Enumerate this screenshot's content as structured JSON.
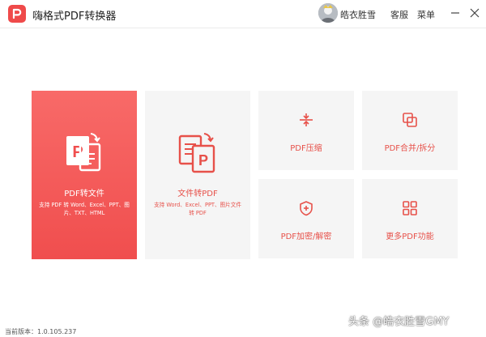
{
  "app": {
    "title": "嗨格式PDF转换器"
  },
  "header": {
    "username": "皓衣胜雪",
    "service_label": "客服",
    "menu_label": "菜单"
  },
  "cards": {
    "pdf_to_file": {
      "label": "PDF转文件",
      "desc": "支持 PDF 转 Word、Excel、PPT、图片、TXT、HTML"
    },
    "file_to_pdf": {
      "label": "文件转PDF",
      "desc": "支持 Word、Excel、PPT、图片文件转 PDF"
    },
    "compress": {
      "label": "PDF压缩"
    },
    "merge_split": {
      "label": "PDF合并/拆分"
    },
    "encrypt": {
      "label": "PDF加密/解密"
    },
    "more": {
      "label": "更多PDF功能"
    }
  },
  "footer": {
    "version": "当前版本：1.0.105.237",
    "watermark": "头条 @皓衣胜雪GMY"
  },
  "colors": {
    "accent": "#f04e4e",
    "card_bg": "#f5f5f5",
    "text_red": "#e7514a"
  }
}
